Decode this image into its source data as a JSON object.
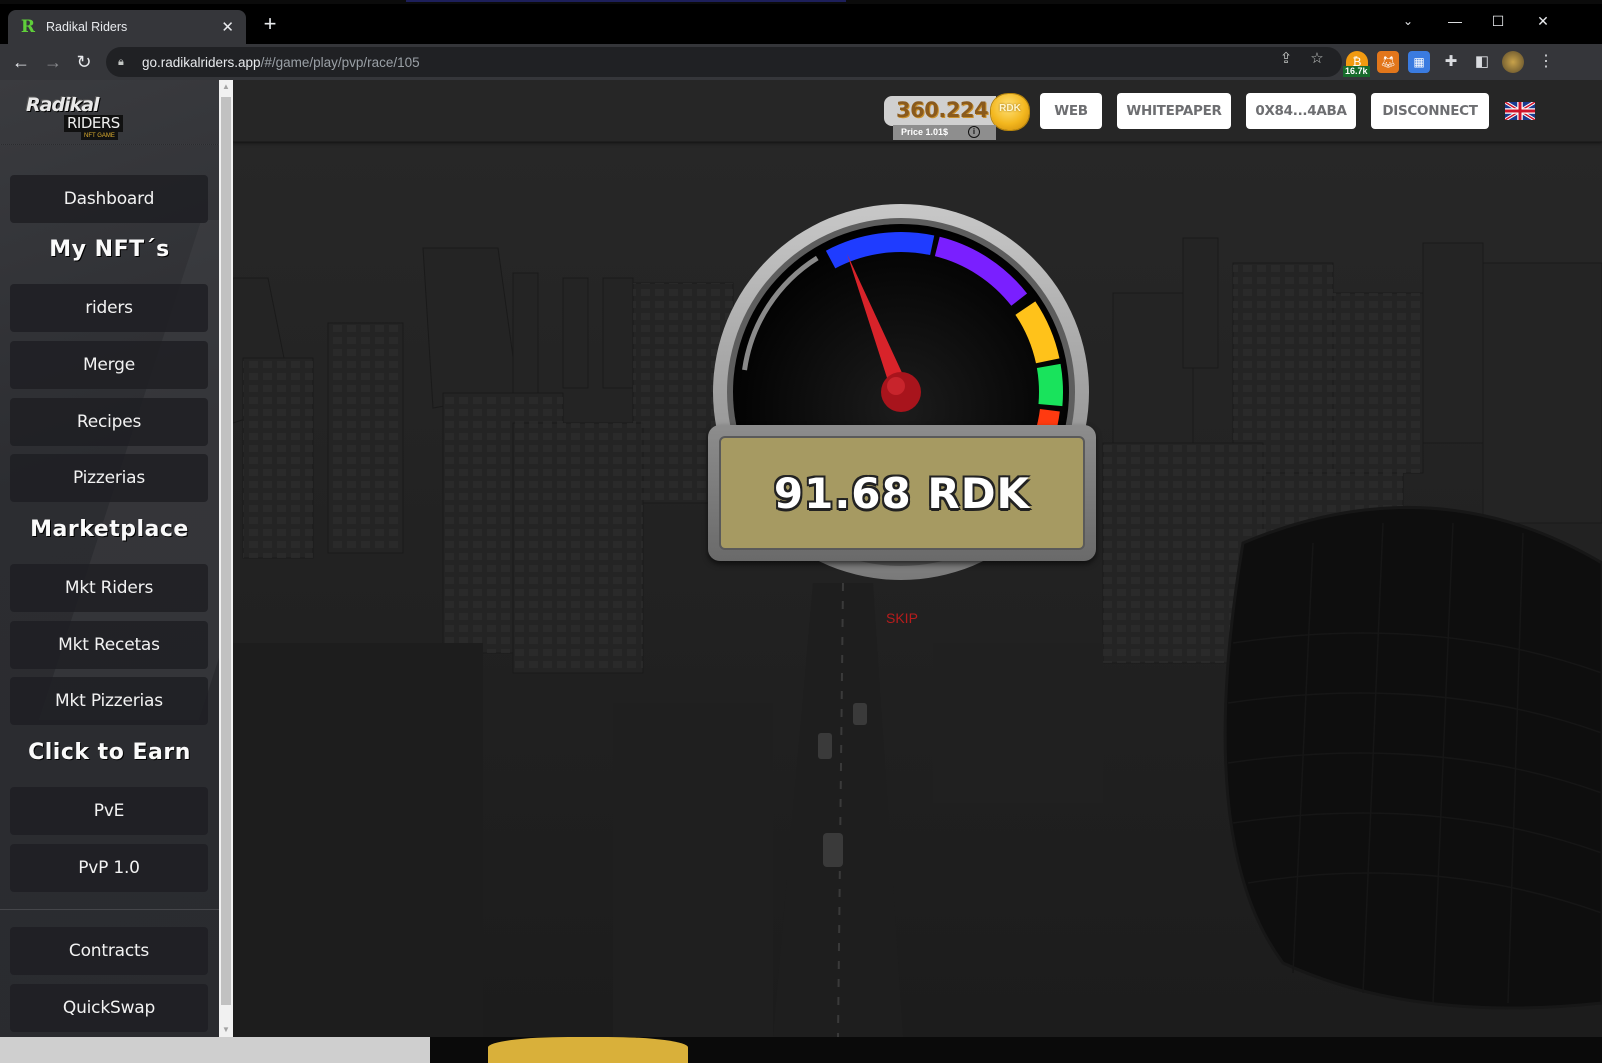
{
  "browser": {
    "tab_title": "Radikal Riders",
    "favicon_letter": "R",
    "tab_close_glyph": "✕",
    "new_tab_glyph": "+",
    "url_domain": "go.radikalriders.app",
    "url_path": "/#/game/play/pvp/race/105",
    "extension_badge": "16.7k",
    "window_controls": {
      "tab_search": "⌄",
      "minimize": "—",
      "maximize": "☐",
      "close": "✕"
    }
  },
  "sidebar": {
    "logo": {
      "line1": "Radikal",
      "line2": "RIDERS",
      "line3": "NFT GAME"
    },
    "items": [
      {
        "type": "button",
        "label": "Dashboard"
      },
      {
        "type": "heading",
        "label": "My NFT´s"
      },
      {
        "type": "button",
        "label": "riders"
      },
      {
        "type": "button",
        "label": "Merge"
      },
      {
        "type": "button",
        "label": "Recipes"
      },
      {
        "type": "button",
        "label": "Pizzerias"
      },
      {
        "type": "heading",
        "label": "Marketplace"
      },
      {
        "type": "button",
        "label": "Mkt Riders"
      },
      {
        "type": "button",
        "label": "Mkt Recetas"
      },
      {
        "type": "button",
        "label": "Mkt Pizzerias"
      },
      {
        "type": "heading",
        "label": "Click to Earn"
      },
      {
        "type": "button",
        "label": "PvE"
      },
      {
        "type": "button",
        "label": "PvP 1.0"
      },
      {
        "type": "button",
        "label": "Contracts"
      },
      {
        "type": "button",
        "label": "QuickSwap"
      }
    ]
  },
  "header": {
    "balance": "360.224",
    "coin_label": "RDK",
    "price": "Price 1.01$",
    "info_glyph": "i",
    "buttons": {
      "web": "WEB",
      "whitepaper": "WHITEPAPER",
      "wallet": "0X84...4ABA",
      "disconnect": "DISCONNECT"
    },
    "language": "en-GB"
  },
  "race_result": {
    "reward_text": "91.68 RDK",
    "reward_amount": 91.68,
    "currency": "RDK",
    "skip_label": "SKIP",
    "gauge": {
      "needle_fraction": 0.12,
      "segments": [
        {
          "name": "grey",
          "color": "#8a8a8a"
        },
        {
          "name": "blue",
          "color": "#1f3cff"
        },
        {
          "name": "purple",
          "color": "#7a1fff"
        },
        {
          "name": "yellow",
          "color": "#ffc21a"
        },
        {
          "name": "green",
          "color": "#19e35c"
        },
        {
          "name": "red",
          "color": "#ff3a10"
        }
      ],
      "needle_color": "#d8232a"
    }
  },
  "colors": {
    "skip": "#b71c1c",
    "readout_panel": "#a69a62",
    "balance_text": "#8a5a1c"
  }
}
